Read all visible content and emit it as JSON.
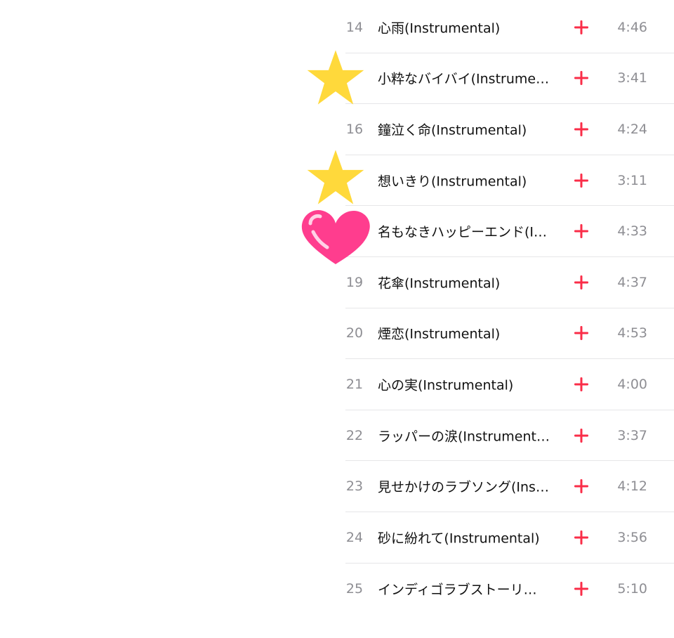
{
  "colors": {
    "accent": "#fa2d48",
    "star": "#ffd93b",
    "heart": "#ff3d8e",
    "secondary_text": "#8e8e93",
    "primary_text": "#111111",
    "divider": "#e6e6e8"
  },
  "tracks": [
    {
      "number": "14",
      "title": "心雨(Instrumental)",
      "duration": "4:46"
    },
    {
      "number": "",
      "title": "小粋なバイバイ(Instrume…",
      "duration": "3:41"
    },
    {
      "number": "16",
      "title": "鐘泣く命(Instrumental)",
      "duration": "4:24"
    },
    {
      "number": "",
      "title": "想いきり(Instrumental)",
      "duration": "3:11"
    },
    {
      "number": "",
      "title": "名もなきハッピーエンド(I…",
      "duration": "4:33"
    },
    {
      "number": "19",
      "title": "花傘(Instrumental)",
      "duration": "4:37"
    },
    {
      "number": "20",
      "title": "煙恋(Instrumental)",
      "duration": "4:53"
    },
    {
      "number": "21",
      "title": "心の実(Instrumental)",
      "duration": "4:00"
    },
    {
      "number": "22",
      "title": "ラッパーの涙(Instrument…",
      "duration": "3:37"
    },
    {
      "number": "23",
      "title": "見せかけのラブソング(Ins…",
      "duration": "4:12"
    },
    {
      "number": "24",
      "title": "砂に紛れて(Instrumental)",
      "duration": "3:56"
    },
    {
      "number": "25",
      "title": "インディゴラブストーリ…",
      "duration": "5:10"
    }
  ],
  "icons": {
    "add": "plus-icon",
    "sticker_star": "star-sticker-icon",
    "sticker_heart": "heart-sticker-icon"
  }
}
